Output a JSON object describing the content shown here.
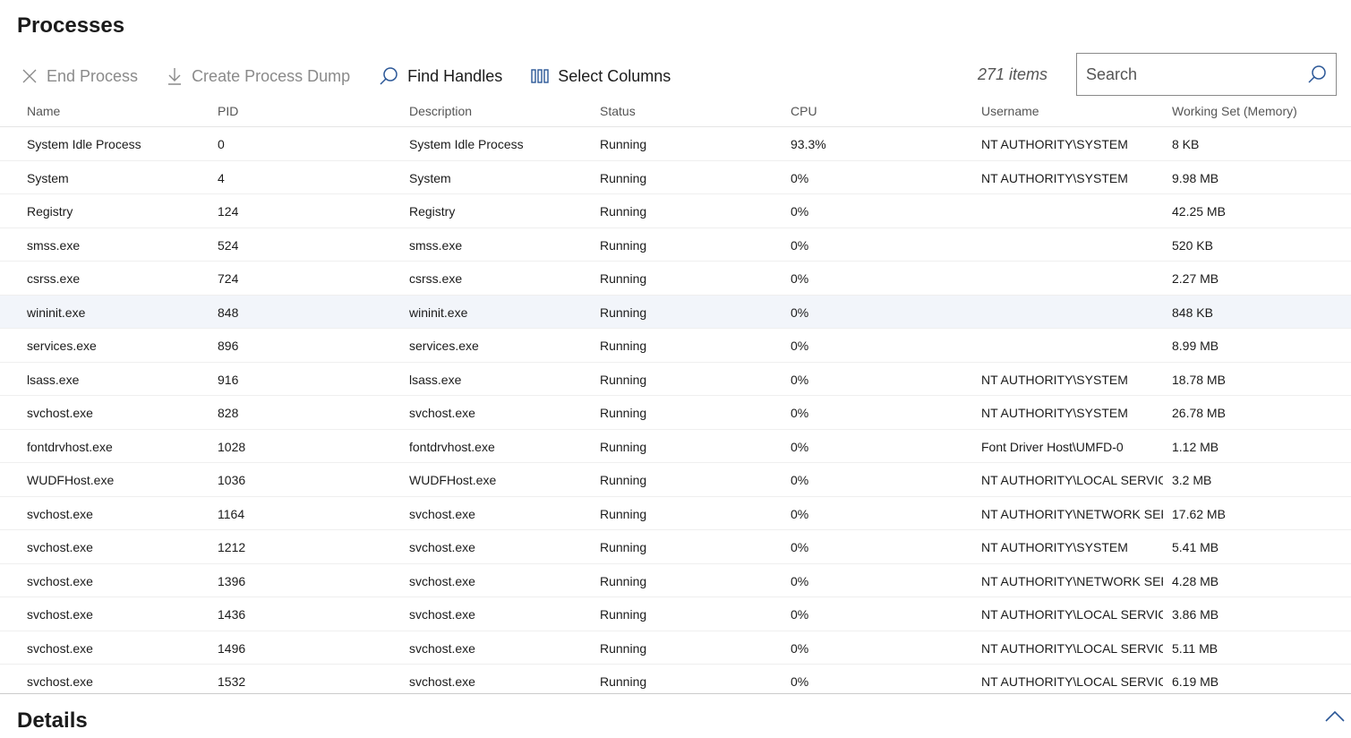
{
  "title": "Processes",
  "toolbar": {
    "end_process": "End Process",
    "create_dump": "Create Process Dump",
    "find_handles": "Find Handles",
    "select_columns": "Select Columns"
  },
  "item_count": "271 items",
  "search": {
    "placeholder": "Search",
    "value": ""
  },
  "columns": [
    "Name",
    "PID",
    "Description",
    "Status",
    "CPU",
    "Username",
    "Working Set (Memory)"
  ],
  "rows": [
    [
      "System Idle Process",
      "0",
      "System Idle Process",
      "Running",
      "93.3%",
      "NT AUTHORITY\\SYSTEM",
      "8 KB"
    ],
    [
      "System",
      "4",
      "System",
      "Running",
      "0%",
      "NT AUTHORITY\\SYSTEM",
      "9.98 MB"
    ],
    [
      "Registry",
      "124",
      "Registry",
      "Running",
      "0%",
      "",
      "42.25 MB"
    ],
    [
      "smss.exe",
      "524",
      "smss.exe",
      "Running",
      "0%",
      "",
      "520 KB"
    ],
    [
      "csrss.exe",
      "724",
      "csrss.exe",
      "Running",
      "0%",
      "",
      "2.27 MB"
    ],
    [
      "wininit.exe",
      "848",
      "wininit.exe",
      "Running",
      "0%",
      "",
      "848 KB"
    ],
    [
      "services.exe",
      "896",
      "services.exe",
      "Running",
      "0%",
      "",
      "8.99 MB"
    ],
    [
      "lsass.exe",
      "916",
      "lsass.exe",
      "Running",
      "0%",
      "NT AUTHORITY\\SYSTEM",
      "18.78 MB"
    ],
    [
      "svchost.exe",
      "828",
      "svchost.exe",
      "Running",
      "0%",
      "NT AUTHORITY\\SYSTEM",
      "26.78 MB"
    ],
    [
      "fontdrvhost.exe",
      "1028",
      "fontdrvhost.exe",
      "Running",
      "0%",
      "Font Driver Host\\UMFD-0",
      "1.12 MB"
    ],
    [
      "WUDFHost.exe",
      "1036",
      "WUDFHost.exe",
      "Running",
      "0%",
      "NT AUTHORITY\\LOCAL SERVICE",
      "3.2 MB"
    ],
    [
      "svchost.exe",
      "1164",
      "svchost.exe",
      "Running",
      "0%",
      "NT AUTHORITY\\NETWORK SERVICE",
      "17.62 MB"
    ],
    [
      "svchost.exe",
      "1212",
      "svchost.exe",
      "Running",
      "0%",
      "NT AUTHORITY\\SYSTEM",
      "5.41 MB"
    ],
    [
      "svchost.exe",
      "1396",
      "svchost.exe",
      "Running",
      "0%",
      "NT AUTHORITY\\NETWORK SERVICE",
      "4.28 MB"
    ],
    [
      "svchost.exe",
      "1436",
      "svchost.exe",
      "Running",
      "0%",
      "NT AUTHORITY\\LOCAL SERVICE",
      "3.86 MB"
    ],
    [
      "svchost.exe",
      "1496",
      "svchost.exe",
      "Running",
      "0%",
      "NT AUTHORITY\\LOCAL SERVICE",
      "5.11 MB"
    ],
    [
      "svchost.exe",
      "1532",
      "svchost.exe",
      "Running",
      "0%",
      "NT AUTHORITY\\LOCAL SERVICE",
      "6.19 MB"
    ]
  ],
  "selected_row": 5,
  "details_title": "Details",
  "colors": {
    "accent": "#2b5797",
    "disabled": "#8a8a8a",
    "selected_row": "#f2f5fa"
  }
}
